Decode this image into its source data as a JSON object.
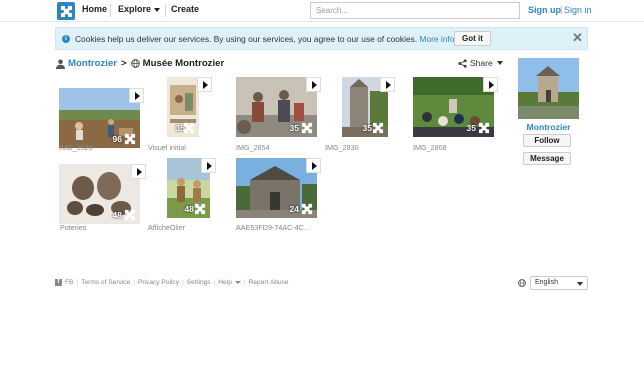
{
  "topbar": {
    "home": "Home",
    "explore": "Explore",
    "create": "Create",
    "search_placeholder": "Search...",
    "signup": "Sign up",
    "separator": "|",
    "signin": "Sign in"
  },
  "cookie": {
    "text": "Cookies help us deliver our services. By using our services, you agree to our use of cookies.",
    "more_info": "More info.",
    "got_it": "Got it",
    "close": "✕"
  },
  "breadcrumb": {
    "user": "Montrozier",
    "separator": ">",
    "album": "Musée Montrozier"
  },
  "share_label": "Share",
  "puzzles": [
    {
      "label": "IMG_1528",
      "count": "96"
    },
    {
      "label": "Visuel initial",
      "count": "35"
    },
    {
      "label": "IMG_2854",
      "count": "35"
    },
    {
      "label": "IMG_2830",
      "count": "35"
    },
    {
      "label": "IMG_2808",
      "count": "35"
    },
    {
      "label": "Poteries",
      "count": "48"
    },
    {
      "label": "AfficheOlier",
      "count": "48"
    },
    {
      "label": "AAE53FD9-74AC-4C...",
      "count": "24"
    }
  ],
  "profile": {
    "name": "Montrozier",
    "follow": "Follow",
    "message": "Message"
  },
  "footer": {
    "fb": "FB",
    "terms": "Terms of Service",
    "privacy": "Privacy Policy",
    "settings": "Settings",
    "help": "Help",
    "report": "Report Abuse",
    "language": "English"
  },
  "colors": {
    "accent": "#2e86c1",
    "banner_bg": "#dff1f8"
  }
}
